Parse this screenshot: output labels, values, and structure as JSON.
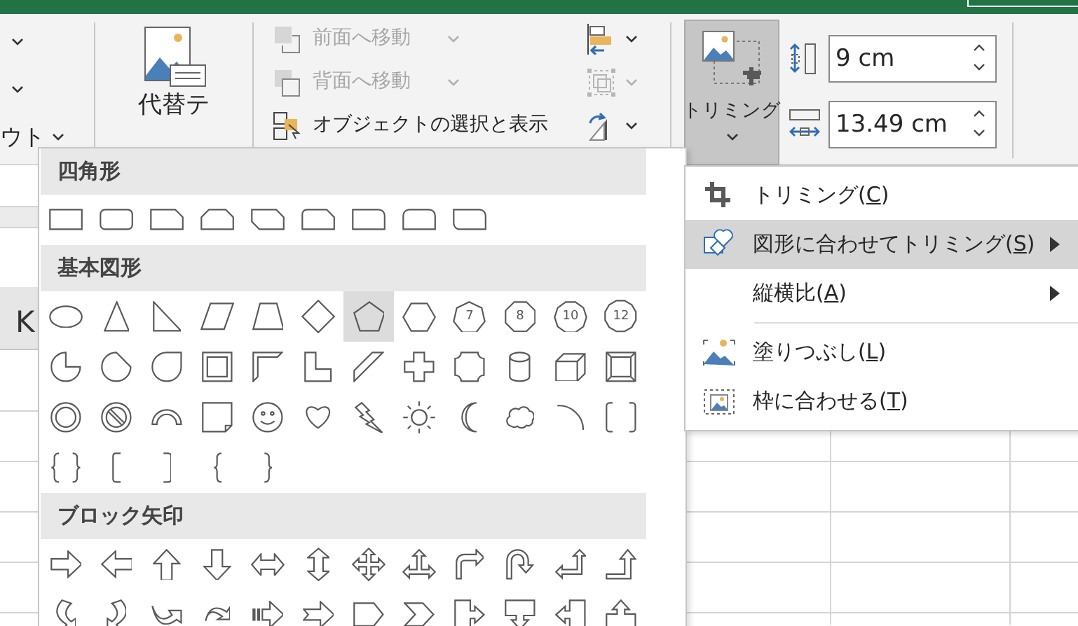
{
  "ribbon": {
    "left_group": {
      "label": "ウト"
    },
    "alt_text": {
      "lines": [
        "代替テ"
      ]
    },
    "arrange": [
      {
        "label": "前面へ移動",
        "disabled": true,
        "dropdown": true
      },
      {
        "label": "背面へ移動",
        "disabled": true,
        "dropdown": true
      },
      {
        "label": "オブジェクトの選択と表示",
        "disabled": false,
        "dropdown": false
      }
    ],
    "arrange_tools": [
      {
        "disabled": false
      },
      {
        "disabled": true
      },
      {
        "disabled": false
      }
    ],
    "crop": {
      "label": "トリミング",
      "pressed": true
    },
    "size": [
      {
        "value": "9 cm"
      },
      {
        "value": "13.49 cm"
      }
    ]
  },
  "sheet": {
    "column_header": "K"
  },
  "shapes_gallery": {
    "sections": [
      {
        "title": "四角形",
        "items": [
          {
            "hovered": false
          },
          {
            "hovered": false
          },
          {
            "hovered": false
          },
          {
            "hovered": false
          },
          {
            "hovered": false
          },
          {
            "hovered": false
          },
          {
            "hovered": false
          },
          {
            "hovered": false
          },
          {
            "hovered": false
          }
        ]
      },
      {
        "title": "基本図形",
        "items": [
          {
            "hovered": false
          },
          {
            "hovered": false
          },
          {
            "hovered": false
          },
          {
            "hovered": false
          },
          {
            "hovered": false
          },
          {
            "hovered": false
          },
          {
            "hovered": true
          },
          {
            "hovered": false
          },
          {
            "hovered": false,
            "label": "7"
          },
          {
            "hovered": false,
            "label": "8"
          },
          {
            "hovered": false,
            "label": "10"
          },
          {
            "hovered": false,
            "label": "12"
          },
          {
            "hovered": false
          },
          {
            "hovered": false
          },
          {
            "hovered": false
          },
          {
            "hovered": false
          },
          {
            "hovered": false
          },
          {
            "hovered": false
          },
          {
            "hovered": false
          },
          {
            "hovered": false
          },
          {
            "hovered": false
          },
          {
            "hovered": false
          },
          {
            "hovered": false
          },
          {
            "hovered": false
          },
          {
            "hovered": false
          },
          {
            "hovered": false
          },
          {
            "hovered": false
          },
          {
            "hovered": false
          },
          {
            "hovered": false
          },
          {
            "hovered": false
          },
          {
            "hovered": false
          },
          {
            "hovered": false
          },
          {
            "hovered": false
          },
          {
            "hovered": false
          },
          {
            "hovered": false
          },
          {
            "hovered": false
          },
          {
            "hovered": false
          },
          {
            "hovered": false
          },
          {
            "hovered": false
          },
          {
            "hovered": false
          },
          {
            "hovered": false
          }
        ]
      },
      {
        "title": "ブロック矢印",
        "items": [
          {
            "hovered": false
          },
          {
            "hovered": false
          },
          {
            "hovered": false
          },
          {
            "hovered": false
          },
          {
            "hovered": false
          },
          {
            "hovered": false
          },
          {
            "hovered": false
          },
          {
            "hovered": false
          },
          {
            "hovered": false
          },
          {
            "hovered": false
          },
          {
            "hovered": false
          },
          {
            "hovered": false
          },
          {
            "hovered": false
          },
          {
            "hovered": false
          },
          {
            "hovered": false
          },
          {
            "hovered": false
          },
          {
            "hovered": false
          },
          {
            "hovered": false
          },
          {
            "hovered": false
          },
          {
            "hovered": false
          },
          {
            "hovered": false
          },
          {
            "hovered": false
          },
          {
            "hovered": false
          },
          {
            "hovered": false
          }
        ]
      }
    ]
  },
  "crop_menu": [
    {
      "kind": "item",
      "before": "トリミング(",
      "key": "C",
      "after": ")",
      "highlighted": false,
      "submenu": false
    },
    {
      "kind": "item",
      "before": "図形に合わせてトリミング(",
      "key": "S",
      "after": ")",
      "highlighted": true,
      "submenu": true
    },
    {
      "kind": "item",
      "before": "縦横比(",
      "key": "A",
      "after": ")",
      "highlighted": false,
      "submenu": true
    },
    {
      "kind": "separator"
    },
    {
      "kind": "item",
      "before": "塗りつぶし(",
      "key": "L",
      "after": ")",
      "highlighted": false,
      "submenu": false
    },
    {
      "kind": "item",
      "before": "枠に合わせる(",
      "key": "T",
      "after": ")",
      "highlighted": false,
      "submenu": false
    }
  ]
}
